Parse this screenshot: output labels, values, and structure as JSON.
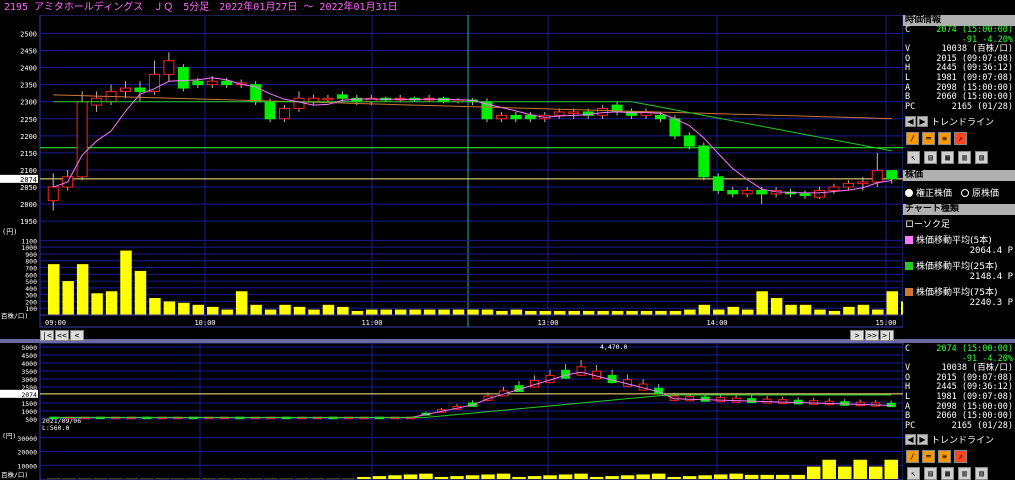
{
  "title": "2195 アミタホールディングス　ＪＱ　5分足　2022年01月27日 ～ 2022年01月31日",
  "colors": {
    "background": "#000000",
    "grid": "#1a1a9a",
    "up": "#ff2020",
    "down": "#00ee00",
    "ma5": "#ff77ff",
    "ma25": "#22cc22",
    "ma75": "#cc7733",
    "volume": "#ffff00",
    "priceline": "#33ff33"
  },
  "upper_chart": {
    "price_ticks": [
      "2500",
      "2450",
      "2400",
      "2350",
      "2300",
      "2250",
      "2200",
      "2150",
      "2100",
      "2074",
      "2050",
      "2000",
      "1950"
    ],
    "current_label": "2074",
    "volume_unit": "(円)",
    "volume_ticks": [
      "1100",
      "1000",
      "900",
      "800",
      "700",
      "600",
      "500",
      "400",
      "300",
      "200",
      "100"
    ],
    "volume_axis_label": "百株/口)",
    "time_labels": [
      "09:00",
      "10:00",
      "11:00",
      "13:00",
      "14:00",
      "15:00"
    ]
  },
  "lower_chart": {
    "price_ticks": [
      "5000",
      "4500",
      "4000",
      "3500",
      "3000",
      "2500",
      "2074",
      "1500",
      "1000",
      "500"
    ],
    "current_label": "2074",
    "annotation_top": "4,470.0",
    "annotation_low_date": "2021/09/06",
    "annotation_low": "L:560.0",
    "volume_unit": "(円)",
    "volume_ticks": [
      "30000",
      "20000",
      "10000"
    ],
    "volume_axis_label": "百株/口)"
  },
  "info": {
    "header": "時価情報",
    "rows": [
      {
        "k": "C",
        "v": "2074 (15:00:00)",
        "green": true
      },
      {
        "k": "",
        "v": "-91 -4.20%",
        "green": true
      },
      {
        "k": "V",
        "v": "10038 (百株/口)",
        "green": false
      },
      {
        "k": "O",
        "v": "2015 (09:07:08)",
        "green": false
      },
      {
        "k": "H",
        "v": "2445 (09:36:12)",
        "green": false
      },
      {
        "k": "L",
        "v": "1981 (09:07:08)",
        "green": false
      },
      {
        "k": "A",
        "v": "2098 (15:00:00)",
        "green": false
      },
      {
        "k": "B",
        "v": "2060 (15:00:00)",
        "green": false
      },
      {
        "k": "PC",
        "v": "2165 (01/28)",
        "green": false
      }
    ],
    "trendline": "トレンドライン",
    "price_header": "株価",
    "radio_adjusted": "権正株価",
    "radio_raw": "原株価",
    "chart_settings_header": "チャート種類",
    "chart_kind": "ローソク足",
    "ma": [
      {
        "label": "株価移動平均(5本)",
        "value": "2064.4 P",
        "color": "#ff77ff"
      },
      {
        "label": "株価移動平均(25本)",
        "value": "2148.4 P",
        "color": "#22cc22"
      },
      {
        "label": "株価移動平均(75本)",
        "value": "2240.3 P",
        "color": "#cc7733"
      }
    ]
  },
  "info2": {
    "rows": [
      {
        "k": "C",
        "v": "2074 (15:00:00)",
        "green": true
      },
      {
        "k": "",
        "v": "-91 -4.20%",
        "green": true
      },
      {
        "k": "V",
        "v": "10038 (百株/口)",
        "green": false
      },
      {
        "k": "O",
        "v": "2015 (09:07:08)",
        "green": false
      },
      {
        "k": "H",
        "v": "2445 (09:36:12)",
        "green": false
      },
      {
        "k": "L",
        "v": "1981 (09:07:08)",
        "green": false
      },
      {
        "k": "A",
        "v": "2098 (15:00:00)",
        "green": false
      },
      {
        "k": "B",
        "v": "2060 (15:00:00)",
        "green": false
      },
      {
        "k": "PC",
        "v": "2165 (01/28)",
        "green": false
      }
    ],
    "trendline": "トレンドライン"
  },
  "nav": {
    "first": "|<",
    "prev_fast": "<<",
    "prev": "<",
    "next": ">",
    "next_fast": ">>",
    "last": ">|"
  },
  "chart_data": [
    {
      "type": "candlestick",
      "title": "",
      "ylim": [
        1950,
        2500
      ],
      "candles": [
        [
          2010,
          2050,
          1981,
          2090
        ],
        [
          2050,
          2080,
          2040,
          2100
        ],
        [
          2080,
          2300,
          2070,
          2330
        ],
        [
          2290,
          2310,
          2270,
          2330
        ],
        [
          2300,
          2330,
          2290,
          2350
        ],
        [
          2330,
          2340,
          2310,
          2360
        ],
        [
          2340,
          2330,
          2300,
          2360
        ],
        [
          2330,
          2380,
          2320,
          2420
        ],
        [
          2380,
          2420,
          2360,
          2445
        ],
        [
          2400,
          2340,
          2330,
          2410
        ],
        [
          2360,
          2350,
          2340,
          2370
        ],
        [
          2350,
          2360,
          2340,
          2375
        ],
        [
          2360,
          2350,
          2340,
          2370
        ],
        [
          2350,
          2355,
          2340,
          2365
        ],
        [
          2350,
          2300,
          2290,
          2360
        ],
        [
          2300,
          2250,
          2240,
          2310
        ],
        [
          2250,
          2280,
          2240,
          2290
        ],
        [
          2280,
          2310,
          2270,
          2330
        ],
        [
          2300,
          2310,
          2290,
          2320
        ],
        [
          2310,
          2310,
          2300,
          2320
        ],
        [
          2320,
          2310,
          2300,
          2330
        ],
        [
          2310,
          2300,
          2290,
          2320
        ],
        [
          2300,
          2310,
          2290,
          2320
        ],
        [
          2310,
          2305,
          2300,
          2315
        ],
        [
          2305,
          2310,
          2300,
          2320
        ],
        [
          2310,
          2305,
          2300,
          2315
        ],
        [
          2305,
          2310,
          2300,
          2320
        ],
        [
          2310,
          2300,
          2295,
          2315
        ],
        [
          2300,
          2305,
          2295,
          2310
        ],
        [
          2305,
          2300,
          2290,
          2310
        ],
        [
          2300,
          2250,
          2240,
          2310
        ],
        [
          2250,
          2260,
          2240,
          2270
        ],
        [
          2260,
          2250,
          2240,
          2270
        ],
        [
          2260,
          2250,
          2240,
          2270
        ],
        [
          2250,
          2260,
          2240,
          2270
        ],
        [
          2260,
          2270,
          2250,
          2280
        ],
        [
          2270,
          2270,
          2250,
          2280
        ],
        [
          2270,
          2260,
          2250,
          2280
        ],
        [
          2260,
          2280,
          2250,
          2290
        ],
        [
          2290,
          2270,
          2260,
          2300
        ],
        [
          2270,
          2260,
          2250,
          2280
        ],
        [
          2260,
          2270,
          2250,
          2280
        ],
        [
          2260,
          2250,
          2240,
          2270
        ],
        [
          2250,
          2200,
          2190,
          2260
        ],
        [
          2200,
          2170,
          2160,
          2210
        ],
        [
          2170,
          2080,
          2070,
          2180
        ],
        [
          2080,
          2040,
          2030,
          2090
        ],
        [
          2040,
          2030,
          2020,
          2050
        ],
        [
          2030,
          2040,
          2020,
          2050
        ],
        [
          2040,
          2030,
          2000,
          2050
        ],
        [
          2030,
          2040,
          2020,
          2050
        ],
        [
          2035,
          2030,
          2020,
          2045
        ],
        [
          2030,
          2025,
          2015,
          2040
        ],
        [
          2020,
          2040,
          2015,
          2050
        ],
        [
          2040,
          2050,
          2030,
          2060
        ],
        [
          2050,
          2060,
          2040,
          2070
        ],
        [
          2060,
          2065,
          2040,
          2080
        ],
        [
          2065,
          2098,
          2050,
          2150
        ],
        [
          2098,
          2074,
          2060,
          2100
        ]
      ],
      "volume": [
        750,
        500,
        750,
        320,
        350,
        950,
        650,
        250,
        200,
        180,
        150,
        120,
        80,
        350,
        150,
        80,
        150,
        120,
        80,
        150,
        120,
        60,
        80,
        80,
        80,
        80,
        80,
        80,
        80,
        80,
        80,
        60,
        80,
        60,
        60,
        60,
        60,
        60,
        60,
        60,
        60,
        60,
        60,
        60,
        80,
        150,
        80,
        120,
        80,
        350,
        250,
        150,
        150,
        80,
        60,
        120,
        150,
        80,
        350,
        200
      ]
    },
    {
      "type": "candlestick",
      "title": "",
      "ylim": [
        0,
        5000
      ],
      "range_low": 560.0,
      "range_high": 4470.0
    }
  ]
}
